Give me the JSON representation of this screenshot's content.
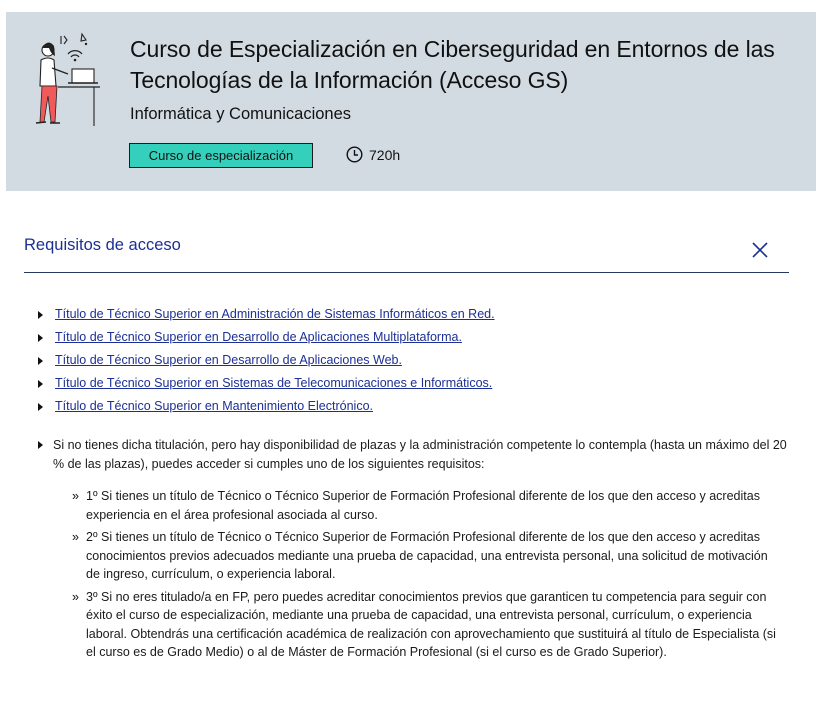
{
  "header": {
    "title": "Curso de Especialización en Ciberseguridad en Entornos de las Tecnologías de la Información (Acceso GS)",
    "family": "Informática y Comunicaciones",
    "badge": "Curso de especialización",
    "hours": "720h",
    "icons": {
      "illustration": "person-at-computer-illustration",
      "hours": "clock-icon"
    }
  },
  "section": {
    "title": "Requisitos de acceso",
    "close_icon": "close-icon"
  },
  "links": [
    "Título de Técnico Superior en Administración de Sistemas Informáticos en Red.",
    "Título de Técnico Superior en Desarrollo de Aplicaciones Multiplataforma.",
    "Título de Técnico Superior en Desarrollo de Aplicaciones Web.",
    "Título de Técnico Superior en Sistemas de Telecomunicaciones e Informáticos.",
    "Título de Técnico Superior en Mantenimiento Electrónico."
  ],
  "requirement": {
    "intro": "Si no tienes dicha titulación, pero hay disponibilidad de plazas y la administración competente lo contempla (hasta un máximo del 20 % de las plazas), puedes acceder si cumples uno de los siguientes requisitos:",
    "items": [
      "1º Si tienes un título de Técnico o Técnico Superior de Formación Profesional diferente de los que den acceso y acreditas experiencia en el área profesional asociada al curso.",
      "2º Si tienes un título de Técnico o Técnico Superior de Formación Profesional diferente de los que den acceso y acreditas conocimientos previos adecuados mediante una prueba de capacidad, una entrevista personal, una solicitud de motivación de ingreso, currículum, o experiencia laboral.",
      "3º Si no eres titulado/a en FP, pero puedes acreditar conocimientos previos que garanticen tu competencia para seguir con éxito el curso de especialización, mediante una prueba de capacidad, una entrevista personal, currículum, o experiencia laboral. Obtendrás una certificación académica de realización con aprovechamiento que sustituirá al título de Especialista (si el curso es de Grado Medio) o al de Máster de Formación Profesional (si el curso es de Grado Superior)."
    ]
  },
  "colors": {
    "header_bg": "#d3dbe2",
    "badge_bg": "#35d0bb",
    "link": "#1c2f94",
    "title_blue": "#1c2f94"
  }
}
